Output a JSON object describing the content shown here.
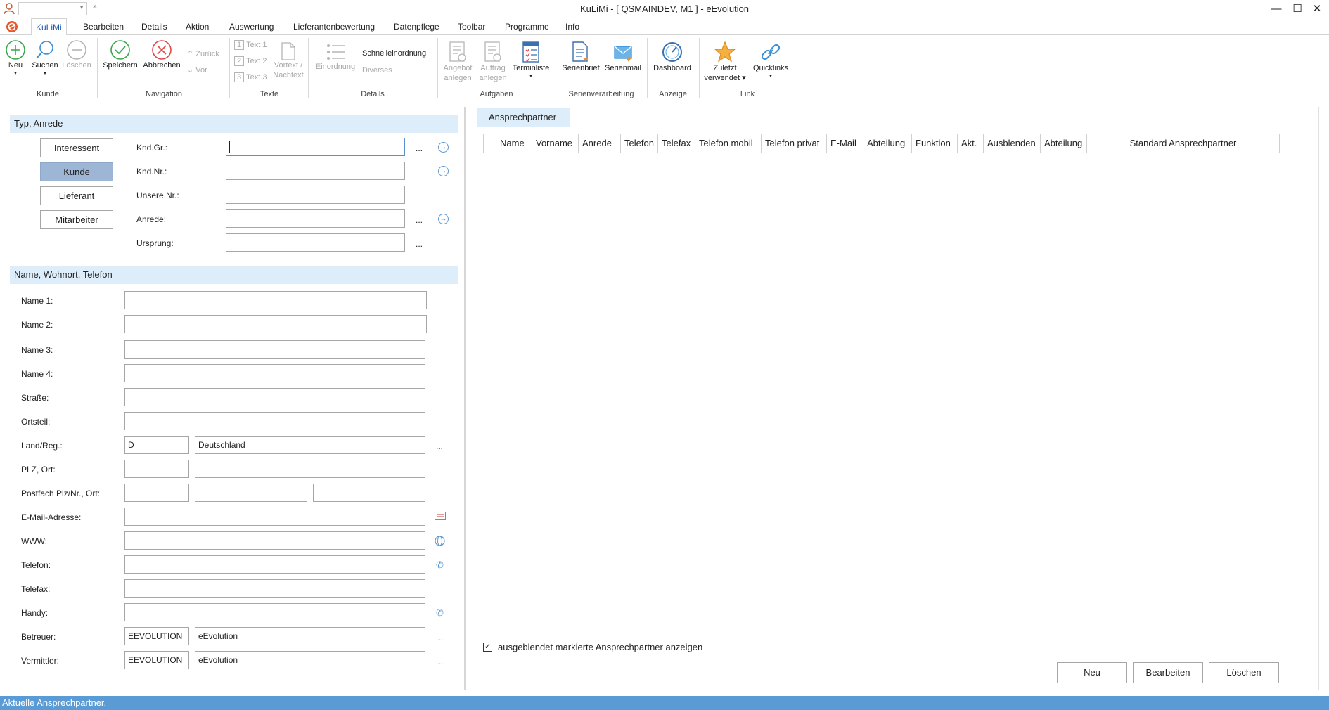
{
  "window": {
    "title": "KuLiMi - [ QSMAINDEV, M1 ]  -  eEvolution"
  },
  "menu": {
    "tabs": [
      "KuLiMi",
      "Bearbeiten",
      "Details",
      "Aktion",
      "Auswertung",
      "Lieferantenbewertung",
      "Datenpflege",
      "Toolbar",
      "Programme",
      "Info"
    ],
    "active": "KuLiMi"
  },
  "ribbon": {
    "kunde": {
      "label": "Kunde",
      "neu": "Neu",
      "suchen": "Suchen",
      "loeschen": "Löschen"
    },
    "navigation": {
      "label": "Navigation",
      "speichern": "Speichern",
      "abbrechen": "Abbrechen",
      "zurueck": "Zurück",
      "vor": "Vor"
    },
    "texte": {
      "label": "Texte",
      "text1": "Text 1",
      "text2": "Text 2",
      "text3": "Text 3",
      "vortext_a": "Vortext /",
      "vortext_b": "Nachtext"
    },
    "details": {
      "label": "Details",
      "einordnung": "Einordnung",
      "schnelleinordnung": "Schnelleinordnung",
      "diverses": "Diverses"
    },
    "aufgaben": {
      "label": "Aufgaben",
      "angebot_a": "Angebot",
      "angebot_b": "anlegen",
      "auftrag_a": "Auftrag",
      "auftrag_b": "anlegen",
      "terminliste": "Terminliste"
    },
    "serien": {
      "label": "Serienverarbeitung",
      "serienbrief": "Serienbrief",
      "serienmail": "Serienmail"
    },
    "anzeige": {
      "label": "Anzeige",
      "dashboard": "Dashboard"
    },
    "link": {
      "label": "Link",
      "zuletzt_a": "Zuletzt",
      "zuletzt_b": "verwendet",
      "quicklinks": "Quicklinks"
    }
  },
  "typ_section": {
    "title": "Typ, Anrede",
    "types": [
      "Interessent",
      "Kunde",
      "Lieferant",
      "Mitarbeiter"
    ],
    "selected": "Kunde",
    "fields": {
      "kndgr": {
        "label": "Knd.Gr.:",
        "value": ""
      },
      "kndnr": {
        "label": "Knd.Nr.:",
        "value": ""
      },
      "unsere_nr": {
        "label": "Unsere Nr.:",
        "value": ""
      },
      "anrede": {
        "label": "Anrede:",
        "value": ""
      },
      "ursprung": {
        "label": "Ursprung:",
        "value": ""
      }
    },
    "dots": "..."
  },
  "name_section": {
    "title": "Name, Wohnort, Telefon",
    "labels": {
      "name1": "Name 1:",
      "name2": "Name 2:",
      "name3": "Name 3:",
      "name4": "Name 4:",
      "strasse": "Straße:",
      "ortsteil": "Ortsteil:",
      "land": "Land/Reg.:",
      "plz": "PLZ, Ort:",
      "postfach": "Postfach Plz/Nr., Ort:",
      "email": "E-Mail-Adresse:",
      "www": "WWW:",
      "telefon": "Telefon:",
      "telefax": "Telefax:",
      "handy": "Handy:",
      "betreuer": "Betreuer:",
      "vermittler": "Vermittler:"
    },
    "values": {
      "land_code": "D",
      "land_name": "Deutschland",
      "betreuer_code": "EEVOLUTION",
      "betreuer_name": "eEvolution",
      "vermittler_code": "EEVOLUTION",
      "vermittler_name": "eEvolution"
    }
  },
  "ansprechpartner": {
    "tab": "Ansprechpartner",
    "columns": [
      "Name",
      "Vorname",
      "Anrede",
      "Telefon",
      "Telefax",
      "Telefon mobil",
      "Telefon privat",
      "E-Mail",
      "Abteilung",
      "Funktion",
      "Akt.",
      "Ausblenden",
      "Abteilung",
      "Standard Ansprechpartner"
    ],
    "checkbox_label": "ausgeblendet markierte Ansprechpartner anzeigen",
    "checked": "✓",
    "buttons": {
      "neu": "Neu",
      "bearbeiten": "Bearbeiten",
      "loeschen": "Löschen"
    }
  },
  "status": {
    "text": "Aktuelle Ansprechpartner."
  },
  "colors": {
    "accent": "#5b9bd5",
    "section_bg": "#ddeefa",
    "selected_type": "#9db6d6"
  }
}
